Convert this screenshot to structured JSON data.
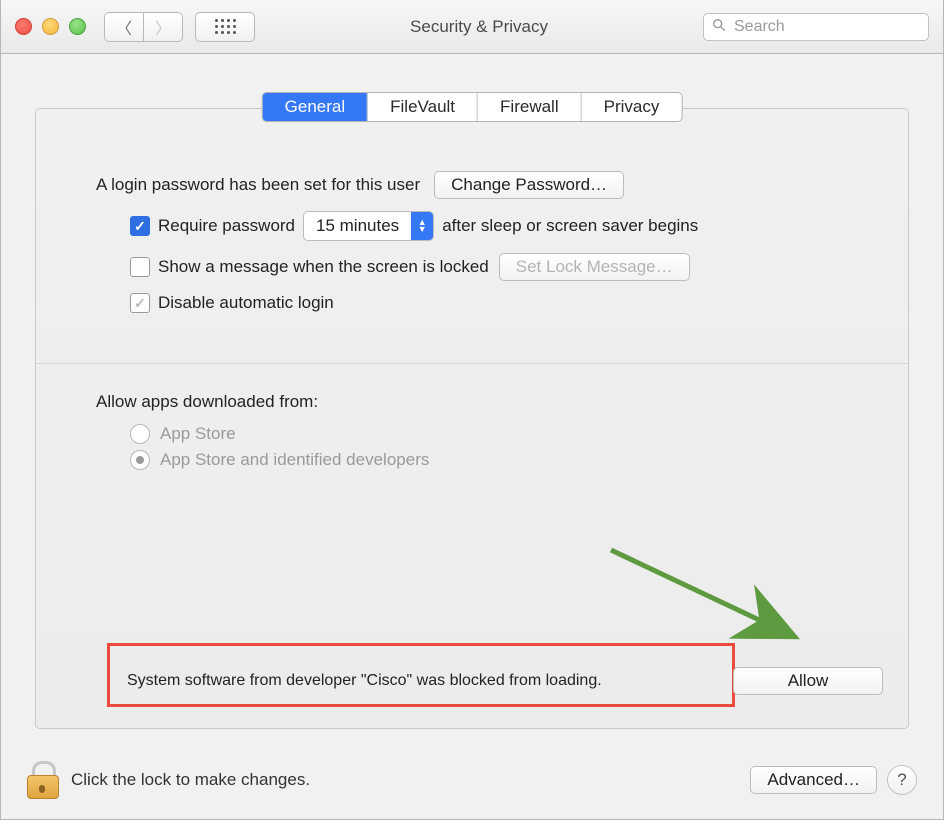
{
  "titlebar": {
    "title": "Security & Privacy",
    "search_placeholder": "Search"
  },
  "tabs": {
    "general": "General",
    "filevault": "FileVault",
    "firewall": "Firewall",
    "privacy": "Privacy"
  },
  "general": {
    "login_pw_text": "A login password has been set for this user",
    "change_password_btn": "Change Password…",
    "require_pw_label": "Require password",
    "require_pw_delay": "15 minutes",
    "require_pw_suffix": "after sleep or screen saver begins",
    "show_message_label": "Show a message when the screen is locked",
    "set_lock_message_btn": "Set Lock Message…",
    "disable_auto_login_label": "Disable automatic login",
    "allow_apps_header": "Allow apps downloaded from:",
    "radio_appstore": "App Store",
    "radio_identified": "App Store and identified developers",
    "blocked_text": "System software from developer \"Cisco\" was blocked from loading.",
    "allow_btn": "Allow"
  },
  "footer": {
    "lock_text": "Click the lock to make changes.",
    "advanced_btn": "Advanced…",
    "help": "?"
  }
}
